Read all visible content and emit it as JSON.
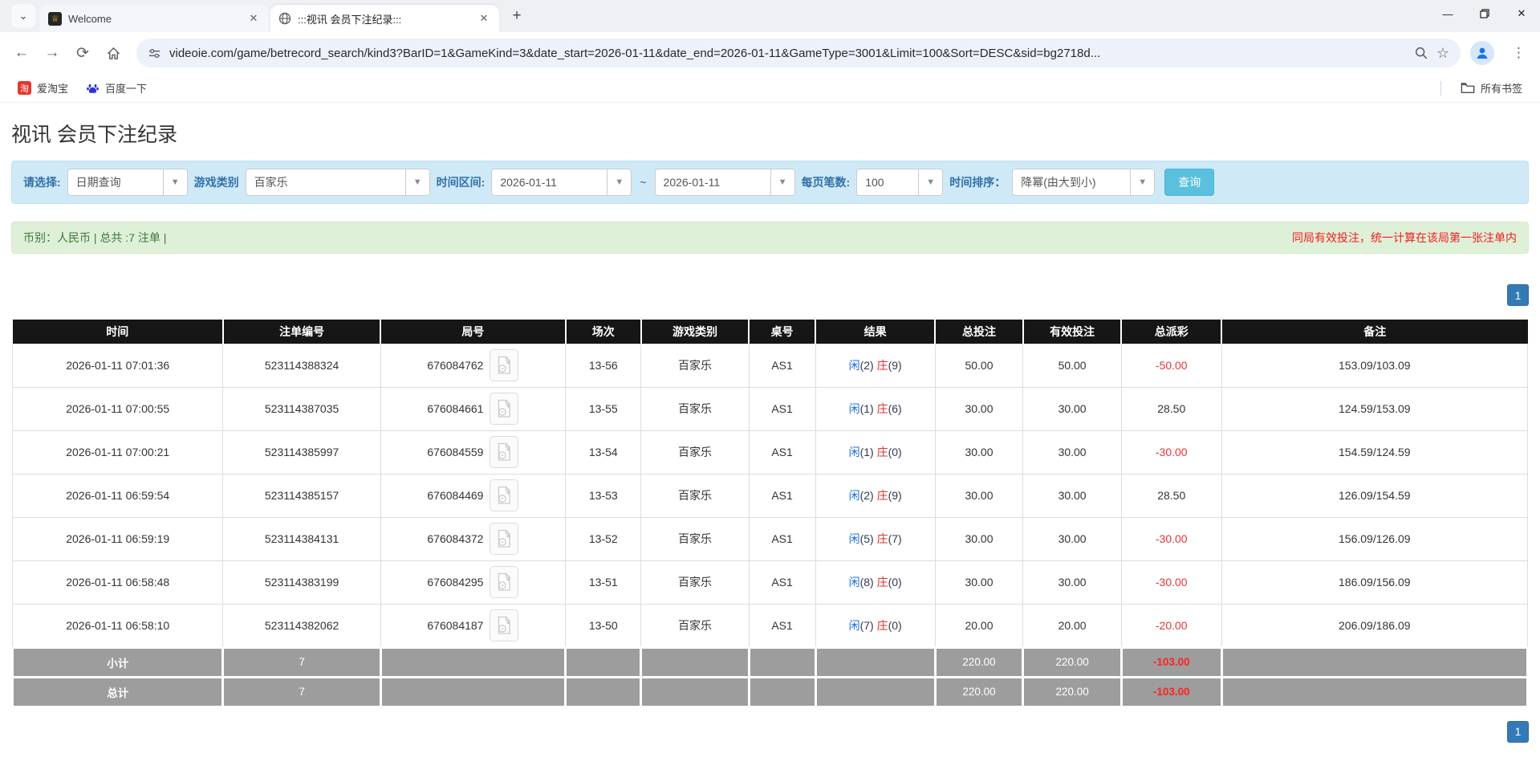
{
  "browser": {
    "tabs": [
      {
        "title": "Welcome",
        "favicon_glyph": "♕"
      },
      {
        "title": ":::视讯 会员下注纪录:::"
      }
    ],
    "new_tab": "+",
    "url": "videoie.com/game/betrecord_search/kind3?BarID=1&GameKind=3&date_start=2026-01-11&date_end=2026-01-11&GameType=3001&Limit=100&Sort=DESC&sid=bg2718d...",
    "bookmarks": {
      "taobao_glyph": "淘",
      "taobao": "爱淘宝",
      "baidu": "百度一下",
      "all_bookmarks": "所有书签"
    }
  },
  "icons": {
    "chevron_down": "⌄",
    "back": "←",
    "forward": "→",
    "reload": "⟳",
    "star": "☆",
    "menu_dots": "⋮",
    "minimize": "—",
    "close": "✕",
    "select_arrow": "▼"
  },
  "page": {
    "title": "视讯 会员下注纪录",
    "filters": {
      "select_label": "请选择:",
      "select_value": "日期查询",
      "game_label": "游戏类别",
      "game_value": "百家乐",
      "range_label": "时间区间:",
      "date_start": "2026-01-11",
      "tilde": "~",
      "date_end": "2026-01-11",
      "per_page_label": "每页笔数:",
      "per_page_value": "100",
      "sort_label": "时间排序：",
      "sort_value": "降幂(由大到小)",
      "search_button": "查询"
    },
    "info": {
      "left": "币别：人民币 | 总共 :7 注单 |",
      "right": "同局有效投注，统一计算在该局第一张注单内"
    },
    "pagination": "1",
    "table": {
      "headers": [
        "时间",
        "注单编号",
        "局号",
        "场次",
        "游戏类别",
        "桌号",
        "结果",
        "总投注",
        "有效投注",
        "总派彩",
        "备注"
      ],
      "rows": [
        {
          "time": "2026-01-11 07:01:36",
          "bet_id": "523114388324",
          "round": "676084762",
          "session": "13-56",
          "game": "百家乐",
          "table_no": "AS1",
          "player_label": "闲",
          "player_val": "(2)",
          "banker_label": "庄",
          "banker_val": "(9)",
          "bet": "50.00",
          "valid": "50.00",
          "payout": "-50.00",
          "remark": "153.09/103.09"
        },
        {
          "time": "2026-01-11 07:00:55",
          "bet_id": "523114387035",
          "round": "676084661",
          "session": "13-55",
          "game": "百家乐",
          "table_no": "AS1",
          "player_label": "闲",
          "player_val": "(1)",
          "banker_label": "庄",
          "banker_val": "(6)",
          "bet": "30.00",
          "valid": "30.00",
          "payout": "28.50",
          "remark": "124.59/153.09"
        },
        {
          "time": "2026-01-11 07:00:21",
          "bet_id": "523114385997",
          "round": "676084559",
          "session": "13-54",
          "game": "百家乐",
          "table_no": "AS1",
          "player_label": "闲",
          "player_val": "(1)",
          "banker_label": "庄",
          "banker_val": "(0)",
          "bet": "30.00",
          "valid": "30.00",
          "payout": "-30.00",
          "remark": "154.59/124.59"
        },
        {
          "time": "2026-01-11 06:59:54",
          "bet_id": "523114385157",
          "round": "676084469",
          "session": "13-53",
          "game": "百家乐",
          "table_no": "AS1",
          "player_label": "闲",
          "player_val": "(2)",
          "banker_label": "庄",
          "banker_val": "(9)",
          "bet": "30.00",
          "valid": "30.00",
          "payout": "28.50",
          "remark": "126.09/154.59"
        },
        {
          "time": "2026-01-11 06:59:19",
          "bet_id": "523114384131",
          "round": "676084372",
          "session": "13-52",
          "game": "百家乐",
          "table_no": "AS1",
          "player_label": "闲",
          "player_val": "(5)",
          "banker_label": "庄",
          "banker_val": "(7)",
          "bet": "30.00",
          "valid": "30.00",
          "payout": "-30.00",
          "remark": "156.09/126.09"
        },
        {
          "time": "2026-01-11 06:58:48",
          "bet_id": "523114383199",
          "round": "676084295",
          "session": "13-51",
          "game": "百家乐",
          "table_no": "AS1",
          "player_label": "闲",
          "player_val": "(8)",
          "banker_label": "庄",
          "banker_val": "(0)",
          "bet": "30.00",
          "valid": "30.00",
          "payout": "-30.00",
          "remark": "186.09/156.09"
        },
        {
          "time": "2026-01-11 06:58:10",
          "bet_id": "523114382062",
          "round": "676084187",
          "session": "13-50",
          "game": "百家乐",
          "table_no": "AS1",
          "player_label": "闲",
          "player_val": "(7)",
          "banker_label": "庄",
          "banker_val": "(0)",
          "bet": "20.00",
          "valid": "20.00",
          "payout": "-20.00",
          "remark": "206.09/186.09"
        }
      ],
      "subtotal": {
        "label": "小计",
        "count": "7",
        "bet": "220.00",
        "valid": "220.00",
        "payout": "-103.00"
      },
      "total": {
        "label": "总计",
        "count": "7",
        "bet": "220.00",
        "valid": "220.00",
        "payout": "-103.00"
      }
    }
  }
}
